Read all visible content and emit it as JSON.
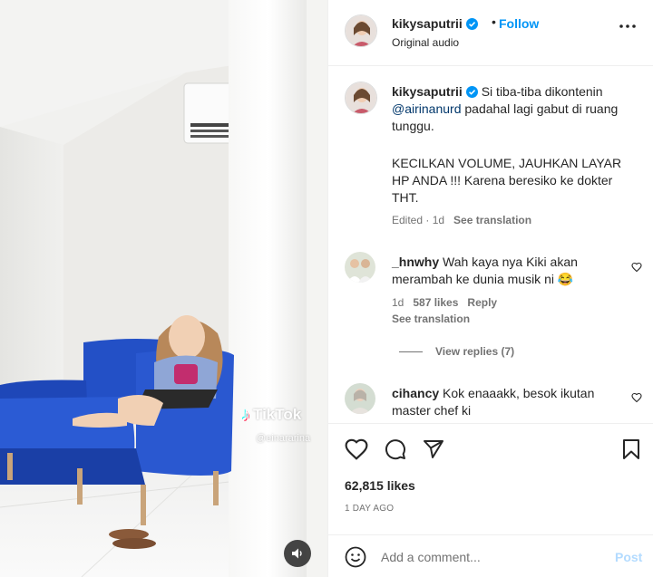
{
  "media": {
    "watermark_brand": "TikTok",
    "watermark_user": "@einararina",
    "audio_icon": "speaker-icon"
  },
  "header": {
    "username": "kikysaputrii",
    "separator": "•",
    "follow_label": "Follow",
    "subtitle": "Original audio"
  },
  "caption": {
    "username": "kikysaputrii",
    "text_1": " Si tiba-tiba dikontenin ",
    "mention": "@airinanurd",
    "text_2": " padahal lagi gabut di ruang tunggu.",
    "text_3": "KECILKAN VOLUME, JAUHKAN LAYAR HP ANDA !!! Karena beresiko ke dokter THT.",
    "edited": "Edited · 1d",
    "see_translation": "See translation"
  },
  "comments": [
    {
      "username": "_hnwhy",
      "text": " Wah kaya nya Kiki akan merambah ke dunia musik ni 😂",
      "age": "1d",
      "likes": "587 likes",
      "reply": "Reply",
      "see_translation": "See translation",
      "view_replies": "View replies (7)"
    },
    {
      "username": "cihancy",
      "text": " Kok enaaakk, besok ikutan master chef ki"
    }
  ],
  "actions": {
    "likes": "62,815 likes",
    "time": "1 DAY AGO"
  },
  "add_comment": {
    "placeholder": "Add a comment...",
    "post_label": "Post"
  },
  "colors": {
    "link_blue": "#0095f6",
    "mention_blue": "#00376b",
    "muted": "#737373",
    "sofa_blue": "#1f4fc9"
  }
}
